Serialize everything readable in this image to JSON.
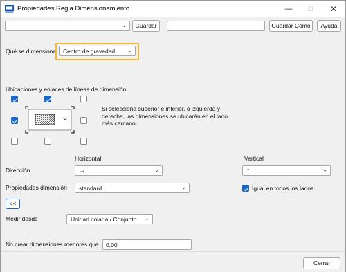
{
  "window": {
    "title": "Propiedades Regla Dimensionamiento"
  },
  "toolbar": {
    "preset_value": "",
    "save_label": "Guardar",
    "save_as_value": "",
    "save_as_label": "Guardar Como",
    "help_label": "Ayuda"
  },
  "dimension": {
    "label": "Qué se dimensiona",
    "value": "Centro de gravedad"
  },
  "locations": {
    "title": "Ubicaciones y enlaces de líneas de dimensión",
    "checks": {
      "top_left": false,
      "top_center": true,
      "top_right": false,
      "mid_left": true,
      "mid_right": false,
      "bottom_left": false,
      "bottom_center": false,
      "bottom_right": false
    },
    "help_text": "Si selecciona superior e inferior, o izquierda y derecha, las dimensiones se ubicarán en el lado más cercano"
  },
  "columns": {
    "horizontal": "Horizontal",
    "vertical": "Vertical"
  },
  "direction": {
    "label": "Dirección",
    "horizontal_value": "→",
    "vertical_value": "↑"
  },
  "dim_props": {
    "label": "Propiedades dimensión",
    "value": "standard",
    "same_all_label": "Igual en todos los lados",
    "same_all_checked": true
  },
  "collapse_label": "<<",
  "measure_from": {
    "label": "Medir desde",
    "value": "Unidad colada / Conjunto"
  },
  "min_dim": {
    "label": "No crear dimensiones menores que",
    "value": "0.00"
  },
  "footer": {
    "cancel_label": "Cerrar"
  },
  "colors": {
    "accent": "#1a66c4",
    "highlight": "#f0b93a"
  }
}
